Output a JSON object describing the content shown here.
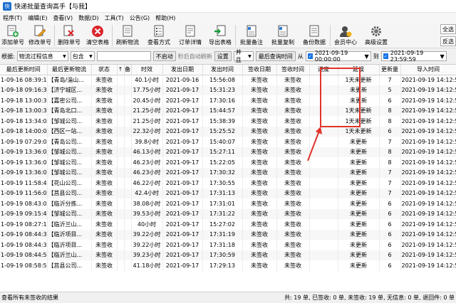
{
  "window": {
    "title": "快递批量查询高手【与我】"
  },
  "menu": [
    "程序(T)",
    "编辑(E)",
    "查看(V)",
    "数据(D)",
    "工具(T)",
    "公告(G)",
    "帮助(H)"
  ],
  "toolbar": [
    {
      "label": "添加单号",
      "icon": "add-doc-icon"
    },
    {
      "label": "修改单号",
      "icon": "edit-pencil-icon"
    },
    {
      "label": "删除单号",
      "icon": "delete-x-icon"
    },
    {
      "label": "清空表格",
      "icon": "clear-circle-icon"
    },
    {
      "label": "刷新物流",
      "icon": "refresh-icon"
    },
    {
      "label": "查看方式",
      "icon": "view-list-icon"
    },
    {
      "label": "订单详情",
      "icon": "order-detail-icon"
    },
    {
      "label": "导出表格",
      "icon": "export-icon"
    },
    {
      "label": "批量备注",
      "icon": "batch-note-icon"
    },
    {
      "label": "批量复制",
      "icon": "batch-copy-icon"
    },
    {
      "label": "备份数据",
      "icon": "backup-icon"
    },
    {
      "label": "会员中心",
      "icon": "member-icon"
    },
    {
      "label": "高级设置",
      "icon": "gear-icon"
    }
  ],
  "side_buttons": [
    "全选",
    "反选"
  ],
  "filter": {
    "label": "根据:",
    "field": "物流过程信息",
    "op": "包含",
    "value": "",
    "not_started": "不启动",
    "auto_refresh": "秒后自动刷新",
    "settings": "设置",
    "logic": "并且",
    "time_field": "最后查询时间",
    "from_label": "从",
    "from_date": "2021-09-19 00:00:00",
    "to_label": "到",
    "to_date": "2021-09-19 23:59:59"
  },
  "table": {
    "columns": [
      "最后更新时间",
      "最后更新物流",
      "状态",
      "↑",
      "备",
      "时效",
      "发出日期",
      "发出时间",
      "签收日期",
      "签收时间",
      "进度",
      "延误",
      "更新量",
      "导入时间"
    ],
    "rows": [
      [
        "1-09-16 08:39:10",
        "【青岛/淄山...",
        "未签收",
        "40.1小时",
        "2021-09-16",
        "15:56:08",
        "未签收",
        "未签收",
        "",
        "1天未更新",
        "7",
        "2021-09-19  14:12:51"
      ],
      [
        "1-09-18 09:16:34",
        "【济宁城区...",
        "未签收",
        "17.75小时",
        "2021-09-17",
        "15:31:23",
        "未签收",
        "未签收",
        "",
        "未更新",
        "5",
        "2021-09-19  14:12:51"
      ],
      [
        "1-09-18 13:00:37",
        "【嘉密公司...",
        "未签收",
        "20.45小时",
        "2021-09-17",
        "17:30:16",
        "未签收",
        "未签收",
        "",
        "未更新",
        "6",
        "2021-09-19  14:12:51"
      ],
      [
        "1-09-18 13:00:30",
        "【青岛北口...",
        "未签收",
        "21.25小时",
        "2021-09-17",
        "15:44:57",
        "未签收",
        "未签收",
        "",
        "1天未更新",
        "8",
        "2021-09-19  14:12:51"
      ],
      [
        "1-09-18 13:34:00",
        "【邹城公司...",
        "未签收",
        "21.25小时",
        "2021-09-17",
        "15:38:39",
        "未签收",
        "未签收",
        "",
        "1天未更新",
        "8",
        "2021-09-19  14:12:51"
      ],
      [
        "1-09-18 14:00:00",
        "【西区一站...",
        "未签收",
        "22.32小时",
        "2021-09-17",
        "15:25:52",
        "未签收",
        "未签收",
        "",
        "1天未更新",
        "6",
        "2021-09-19  14:12:51"
      ],
      [
        "1-09-19 07:29:05",
        "【青岛公司...",
        "未签收",
        "39.8小时",
        "2021-09-17",
        "15:40:07",
        "未签收",
        "未签收",
        "",
        "未更新",
        "7",
        "2021-09-19  14:12:51"
      ],
      [
        "1-09-19 13:36:00",
        "【邹城公司...",
        "未签收",
        "46.13小时",
        "2021-09-17",
        "15:27:11",
        "未签收",
        "未签收",
        "",
        "未更新",
        "8",
        "2021-09-19  14:12:51"
      ],
      [
        "1-09-19 13:36:00",
        "【邹城公司...",
        "未签收",
        "46.23小时",
        "2021-09-17",
        "15:22:05",
        "未签收",
        "未签收",
        "",
        "未更新",
        "8",
        "2021-09-19  14:12:51"
      ],
      [
        "1-09-19 13:36:06",
        "【邹城公司...",
        "未签收",
        "46.23小时",
        "2021-09-17",
        "17:30:32",
        "未签收",
        "未签收",
        "",
        "未更新",
        "7",
        "2021-09-19  14:12:51"
      ],
      [
        "1-09-19 11:58:48",
        "【花山公司...",
        "未签收",
        "46.22小时",
        "2021-09-17",
        "17:30:55",
        "未签收",
        "未签收",
        "",
        "未更新",
        "7",
        "2021-09-19  14:12:51"
      ],
      [
        "1-09-19 11:56:07",
        "【莒县公司...",
        "未签收",
        "42.4小时",
        "2021-09-17",
        "17:31:13",
        "未签收",
        "未签收",
        "",
        "未更新",
        "7",
        "2021-09-19  14:12:51"
      ],
      [
        "1-09-19 08:43:00",
        "【临沂分拣...",
        "未签收",
        "38.08小时",
        "2021-09-17",
        "17:31:01",
        "未签收",
        "未签收",
        "",
        "未更新",
        "6",
        "2021-09-19  14:12:51"
      ],
      [
        "1-09-19 09:15:45",
        "【邹城公司...",
        "未签收",
        "39.53小时",
        "2021-09-17",
        "17:31:22",
        "未签收",
        "未签收",
        "",
        "未更新",
        "6",
        "2021-09-19  14:12:51"
      ],
      [
        "1-09-19 08:27:12",
        "【临沂兰山...",
        "未签收",
        "40小时",
        "2021-09-17",
        "15:27:02",
        "未签收",
        "未签收",
        "",
        "未更新",
        "6",
        "2021-09-19  14:12:51"
      ],
      [
        "1-09-19 08:44:36",
        "【临沂项目...",
        "未签收",
        "39.22小时",
        "2021-09-17",
        "17:31:19",
        "未签收",
        "未签收",
        "",
        "未更新",
        "6",
        "2021-09-19  14:12:51"
      ],
      [
        "1-09-19 08:44:36",
        "【临沂项目...",
        "未签收",
        "39.22小时",
        "2021-09-17",
        "17:31:18",
        "未签收",
        "未签收",
        "",
        "未更新",
        "6",
        "2021-09-19  14:12:51"
      ],
      [
        "1-09-19 08:44:50",
        "【临沂兰山...",
        "未签收",
        "39.23小时",
        "2021-09-17",
        "17:30:59",
        "未签收",
        "未签收",
        "",
        "未更新",
        "6",
        "2021-09-19  14:12:51"
      ],
      [
        "1-09-19 08:58:59",
        "【莒县公司...",
        "未签收",
        "41.18小时",
        "2021-09-17",
        "17:29:13",
        "未签收",
        "未签收",
        "",
        "未更新",
        "6",
        "2021-09-19  14:12:51"
      ]
    ]
  },
  "status": {
    "left": "查看所有未签收的结果",
    "total": "共: 19 单",
    "signed": "已签收: 0 单",
    "unsigned": "未签收: 19 单",
    "no_info": "无信息: 0 单",
    "returned": "退回件: 0 单"
  },
  "colors": {
    "highlight": "#e0342a",
    "accent": "#1a73e8"
  }
}
